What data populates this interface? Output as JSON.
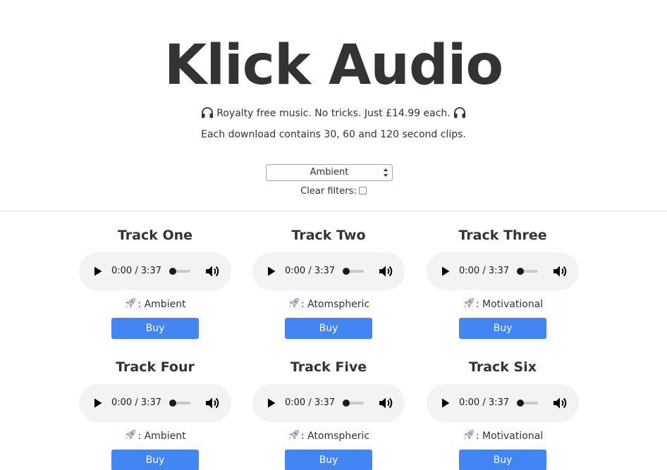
{
  "header": {
    "title": "Klick Audio",
    "tagline": "Royalty free music. No tricks. Just £14.99 each.",
    "tagline_icon": "headphones-icon",
    "subline": "Each download contains 30, 60 and 120 second clips."
  },
  "filters": {
    "genre_selected": "Ambient",
    "clear_label": "Clear filters:",
    "clear_checked": false
  },
  "colors": {
    "accent": "#4285f4",
    "player_bg": "#f1f3f4",
    "text": "#333333"
  },
  "tracks": [
    {
      "title": "Track One",
      "time": "0:00 / 3:37",
      "genre_prefix": ": ",
      "genre": "Ambient",
      "buy_label": "Buy"
    },
    {
      "title": "Track Two",
      "time": "0:00 / 3:37",
      "genre_prefix": ": ",
      "genre": "Atomspheric",
      "buy_label": "Buy"
    },
    {
      "title": "Track Three",
      "time": "0:00 / 3:37",
      "genre_prefix": ": ",
      "genre": "Motivational",
      "buy_label": "Buy"
    },
    {
      "title": "Track Four",
      "time": "0:00 / 3:37",
      "genre_prefix": ": ",
      "genre": "Ambient",
      "buy_label": "Buy"
    },
    {
      "title": "Track Five",
      "time": "0:00 / 3:37",
      "genre_prefix": ": ",
      "genre": "Atomspheric",
      "buy_label": "Buy"
    },
    {
      "title": "Track Six",
      "time": "0:00 / 3:37",
      "genre_prefix": ": ",
      "genre": "Motivational",
      "buy_label": "Buy"
    }
  ]
}
